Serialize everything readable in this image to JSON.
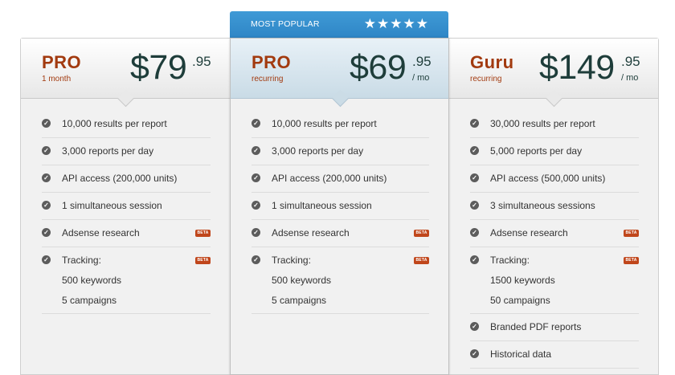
{
  "banner": {
    "label": "MOST POPULAR",
    "stars": "★★★★★"
  },
  "icons": {
    "check": "check-circle-icon",
    "beta": "beta-badge"
  },
  "colors": {
    "plan_name": "#a23a0f",
    "price": "#1e3d3a",
    "banner": "#3593d0",
    "beta": "#c0461b"
  },
  "plans": [
    {
      "name": "PRO",
      "sub": "1 month",
      "price": "$79",
      "cents": ".95",
      "per": "",
      "features": [
        {
          "text": "10,000 results per report"
        },
        {
          "text": "3,000 reports per day"
        },
        {
          "text": "API access (200,000 units)"
        },
        {
          "text": "1 simultaneous session"
        },
        {
          "text": "Adsense research",
          "badge": "BETA"
        },
        {
          "text": "Tracking:",
          "badge": "BETA",
          "sub1": "500 keywords",
          "sub2": "5 campaigns"
        }
      ]
    },
    {
      "name": "PRO",
      "sub": "recurring",
      "price": "$69",
      "cents": ".95",
      "per": "/ mo",
      "features": [
        {
          "text": "10,000 results per report"
        },
        {
          "text": "3,000 reports per day"
        },
        {
          "text": "API access (200,000 units)"
        },
        {
          "text": "1 simultaneous session"
        },
        {
          "text": "Adsense research",
          "badge": "BETA"
        },
        {
          "text": "Tracking:",
          "badge": "BETA",
          "sub1": "500 keywords",
          "sub2": "5 campaigns"
        }
      ]
    },
    {
      "name": "Guru",
      "sub": "recurring",
      "price": "$149",
      "cents": ".95",
      "per": "/ mo",
      "features": [
        {
          "text": "30,000 results per report"
        },
        {
          "text": "5,000 reports per day"
        },
        {
          "text": "API access (500,000 units)"
        },
        {
          "text": "3 simultaneous sessions"
        },
        {
          "text": "Adsense research",
          "badge": "BETA"
        },
        {
          "text": "Tracking:",
          "badge": "BETA",
          "sub1": "1500 keywords",
          "sub2": "50 campaigns"
        },
        {
          "text": "Branded PDF reports"
        },
        {
          "text": "Historical data"
        }
      ]
    }
  ]
}
